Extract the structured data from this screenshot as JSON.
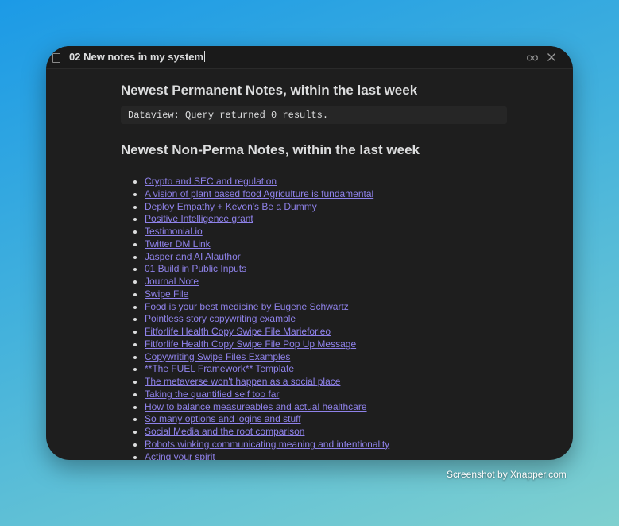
{
  "window": {
    "title": "02 New notes in my system"
  },
  "sections": {
    "permanent_heading": "Newest Permanent Notes, within the last week",
    "query_result": "Dataview: Query returned 0 results.",
    "nonperma_heading": "Newest Non-Perma Notes, within the last week"
  },
  "notes": [
    "Crypto and SEC and regulation",
    "A vision of plant based food Agriculture is fundamental",
    "Deploy Empathy + Kevon's Be a Dummy",
    "Positive Intelligence grant",
    "Testimonial.io",
    "Twitter DM Link",
    "Jasper and AI Alauthor",
    "01 Build in Public Inputs",
    "Journal Note",
    "Swipe File",
    "Food is your best medicine by Eugene Schwartz",
    "Pointless story copywriting example",
    "Fitforlife Health Copy Swipe File Marieforleo",
    "Fitforlife Health Copy Swipe File Pop Up Message",
    "Copywriting Swipe Files Examples",
    "**The FUEL Framework** Template",
    "The metaverse won't happen as a social place",
    "Taking the quantified self too far",
    "How to balance measureables and actual healthcare",
    "So many options and logins and stuff",
    "Social Media and the root comparison",
    "Robots winking communicating meaning and intentionality",
    "Acting your spirit"
  ],
  "credit": "Screenshot by Xnapper.com",
  "colors": {
    "link": "#8f82ea",
    "editor_bg": "#1e1e1e",
    "text": "#dcddde"
  }
}
